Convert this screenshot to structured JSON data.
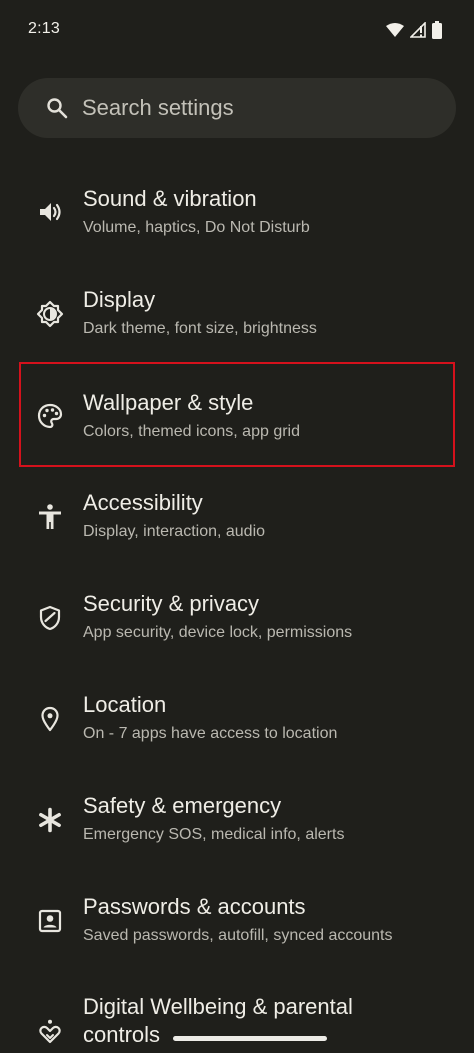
{
  "status_bar": {
    "time": "2:13",
    "icons": [
      "wifi-icon",
      "signal-icon",
      "battery-icon"
    ]
  },
  "search": {
    "placeholder": "Search settings",
    "value": ""
  },
  "settings": [
    {
      "icon": "volume-icon",
      "title": "Sound & vibration",
      "subtitle": "Volume, haptics, Do Not Disturb"
    },
    {
      "icon": "brightness-icon",
      "title": "Display",
      "subtitle": "Dark theme, font size, brightness"
    },
    {
      "icon": "palette-icon",
      "title": "Wallpaper & style",
      "subtitle": "Colors, themed icons, app grid",
      "highlighted": true
    },
    {
      "icon": "accessibility-icon",
      "title": "Accessibility",
      "subtitle": "Display, interaction, audio"
    },
    {
      "icon": "shield-icon",
      "title": "Security & privacy",
      "subtitle": "App security, device lock, permissions"
    },
    {
      "icon": "location-pin-icon",
      "title": "Location",
      "subtitle": "On - 7 apps have access to location"
    },
    {
      "icon": "asterisk-icon",
      "title": "Safety & emergency",
      "subtitle": "Emergency SOS, medical info, alerts"
    },
    {
      "icon": "account-box-icon",
      "title": "Passwords & accounts",
      "subtitle": "Saved passwords, autofill, synced accounts"
    },
    {
      "icon": "wellbeing-icon",
      "title": "Digital Wellbeing & parental",
      "title_line2": "controls"
    }
  ],
  "colors": {
    "background": "#1f1f1b",
    "search_background": "#2e2e29",
    "highlight_border": "#d4111c"
  }
}
